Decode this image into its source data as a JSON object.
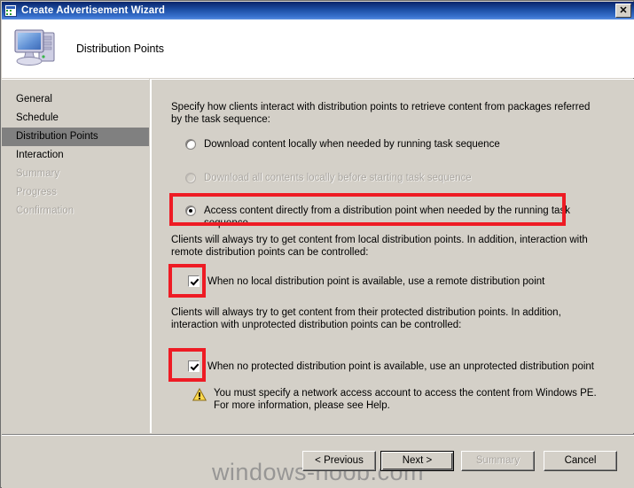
{
  "window": {
    "title": "Create Advertisement Wizard",
    "icon": "wizard-window-icon",
    "close_label": "✕"
  },
  "header": {
    "title": "Distribution Points",
    "icon": "computer-icon"
  },
  "sidebar": {
    "items": [
      {
        "label": "General",
        "state": "enabled"
      },
      {
        "label": "Schedule",
        "state": "enabled"
      },
      {
        "label": "Distribution Points",
        "state": "selected"
      },
      {
        "label": "Interaction",
        "state": "enabled"
      },
      {
        "label": "Summary",
        "state": "disabled"
      },
      {
        "label": "Progress",
        "state": "disabled"
      },
      {
        "label": "Confirmation",
        "state": "disabled"
      }
    ],
    "selected_color": "#808080"
  },
  "content": {
    "intro": "Specify how clients interact with distribution points to retrieve content from packages referred by the task sequence:",
    "radios": [
      {
        "label": "Download content locally when needed by running task sequence",
        "checked": false,
        "disabled": false
      },
      {
        "label": "Download all contents locally before starting task sequence",
        "checked": false,
        "disabled": true
      },
      {
        "label": "Access content directly from a distribution point when needed by the running task sequence",
        "checked": true,
        "disabled": false,
        "highlighted": true
      }
    ],
    "note_local": "Clients will always try to get content from local distribution points. In addition, interaction with remote distribution points can be controlled:",
    "checkbox_remote": {
      "label": "When no local distribution point is available, use a remote distribution point",
      "checked": true,
      "highlighted": true
    },
    "note_protected": "Clients will always try to get content from their protected distribution points. In addition, interaction with unprotected distribution points can be controlled:",
    "checkbox_unprotected": {
      "label": "When no protected distribution point is available, use an unprotected distribution point",
      "checked": true,
      "highlighted": true
    },
    "warning": {
      "icon": "warning-triangle-icon",
      "text": "You must specify a network access account to access the content from Windows PE.  For more information, please see Help."
    },
    "annotation_color": "#ee1b24"
  },
  "footer": {
    "buttons": [
      {
        "label": "< Previous",
        "state": "enabled"
      },
      {
        "label": "Next >",
        "state": "default"
      },
      {
        "label": "Summary",
        "state": "disabled"
      },
      {
        "label": "Cancel",
        "state": "enabled"
      }
    ]
  },
  "watermark": {
    "text": "windows-noob.com"
  }
}
